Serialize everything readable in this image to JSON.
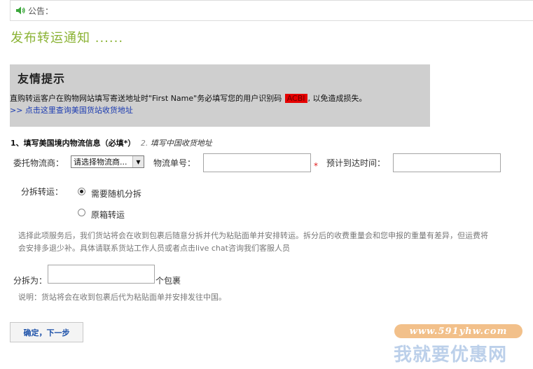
{
  "notice": {
    "label": "公告：",
    "icon": "speaker-icon",
    "icon_color": "#3aa63a"
  },
  "page_title": "发布转运通知 ......",
  "tip": {
    "title": "友情提示",
    "line_before": "直购转运客户在购物网站填写寄送地址时\"First Name\"务必填写您的用户识别码",
    "code": "ACBI",
    "line_after": ", 以免造成损失。",
    "link": ">> 点击这里查询美国货站收货地址"
  },
  "steps": {
    "step1": "1、填写美国境内物流信息（必填*）",
    "step2_num": "2.",
    "step2": "填写中国收货地址"
  },
  "form": {
    "carrier_label": "委托物流商：",
    "carrier_value": "请选择物流商...",
    "tracking_label": "物流单号：",
    "required_mark": "*",
    "eta_label": "预计到达时间：",
    "split_label": "分拆转运：",
    "option_random": "需要随机分拆",
    "option_original": "原箱转运",
    "description": "选择此项服务后，我们货站将会在收到包裹后随意分拆并代为粘贴面单并安排转运。拆分后的收费重量会和您申报的重量有差异，但运费将会安排多退少补。具体请联系货站工作人员或者点击live chat咨询我们客服人员",
    "split_into_label": "分拆为：",
    "package_unit": "个包裹",
    "note": "说明：货站将会在收到包裹后代为粘贴面单并安排发往中国。",
    "submit": "确定，下一步"
  },
  "watermark": {
    "url": "www.591yhw.com",
    "text": "我就要优惠网"
  },
  "colors": {
    "title_green": "#8bb335",
    "code_red": "#e60000",
    "link_blue": "#1a3ab0"
  }
}
